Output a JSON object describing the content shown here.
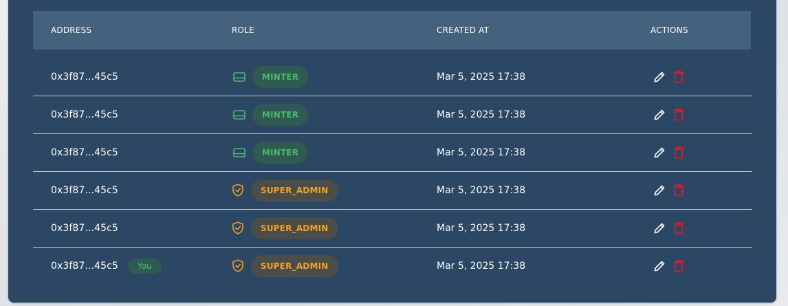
{
  "table": {
    "headers": {
      "address": "ADDRESS",
      "role": "ROLE",
      "created_at": "CREATED AT",
      "actions": "ACTIONS"
    },
    "rows": [
      {
        "address": "0x3f87...45c5",
        "you": "",
        "role": "MINTER",
        "role_icon": "card-icon",
        "created_at": "Mar 5, 2025 17:38"
      },
      {
        "address": "0x3f87...45c5",
        "you": "",
        "role": "MINTER",
        "role_icon": "card-icon",
        "created_at": "Mar 5, 2025 17:38"
      },
      {
        "address": "0x3f87...45c5",
        "you": "",
        "role": "MINTER",
        "role_icon": "card-icon",
        "created_at": "Mar 5, 2025 17:38"
      },
      {
        "address": "0x3f87...45c5",
        "you": "",
        "role": "SUPER_ADMIN",
        "role_icon": "shield-check-icon",
        "created_at": "Mar 5, 2025 17:38"
      },
      {
        "address": "0x3f87...45c5",
        "you": "",
        "role": "SUPER_ADMIN",
        "role_icon": "shield-check-icon",
        "created_at": "Mar 5, 2025 17:38"
      },
      {
        "address": "0x3f87...45c5",
        "you": "You",
        "role": "SUPER_ADMIN",
        "role_icon": "shield-check-icon",
        "created_at": "Mar 5, 2025 17:38"
      }
    ]
  },
  "icons": {
    "edit": "pencil-icon",
    "delete": "trash-icon"
  },
  "colors": {
    "card_background": "#2c4763",
    "header_background": "#44617e",
    "minter_text": "#4cb86c",
    "minter_badge": "#2f5a52",
    "admin_text": "#f3a11e",
    "admin_badge": "#4b4d4a",
    "delete_icon": "#e0192b"
  }
}
